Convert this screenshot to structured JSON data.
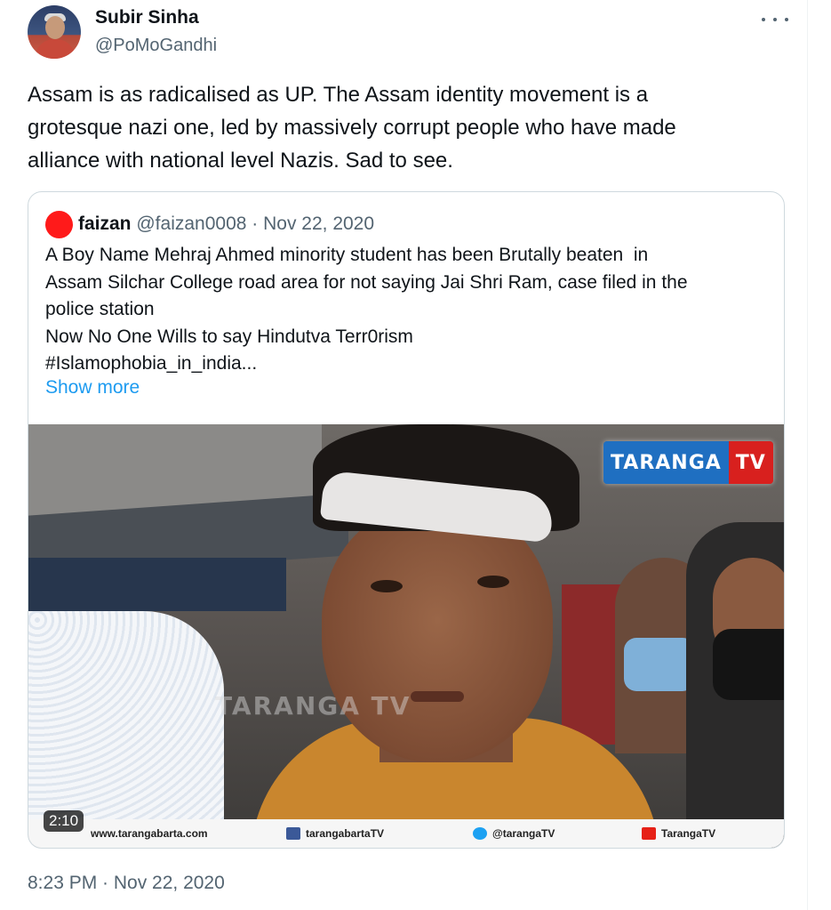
{
  "tweet": {
    "author": {
      "name": "Subir Sinha",
      "handle": "@PoMoGandhi"
    },
    "lines": [
      "Assam is as radicalised as UP. The Assam identity movement is a",
      "grotesque nazi one, led by massively corrupt people who have made",
      "alliance with national level Nazis. Sad to see."
    ],
    "timestamp": "8:23 PM · Nov 22, 2020",
    "more_icon": "ellipsis-icon"
  },
  "quote": {
    "author": {
      "name": "faizan",
      "handle": "@faizan0008",
      "date": "· Nov 22, 2020"
    },
    "lines": [
      "A Boy Name Mehraj Ahmed minority student has been Brutally beaten  in",
      "Assam Silchar College road area for not saying Jai Shri Ram, case filed in the",
      "police station",
      "Now No One Wills to say Hindutva Terr0rism",
      "#Islamophobia_in_india..."
    ],
    "show_more": "Show more",
    "video": {
      "duration": "2:10",
      "logo_left": "TARANGA",
      "logo_right": "TV",
      "watermark": "TARANGA TV",
      "footer": {
        "site": "www.tarangabarta.com",
        "facebook": "tarangabartaTV",
        "twitter": "@tarangaTV",
        "youtube": "TarangaTV"
      }
    }
  },
  "colors": {
    "link": "#1d9bf0",
    "secondary_text": "#536471",
    "border": "#cfd9de",
    "quote_avatar": "#ff1a1a"
  }
}
